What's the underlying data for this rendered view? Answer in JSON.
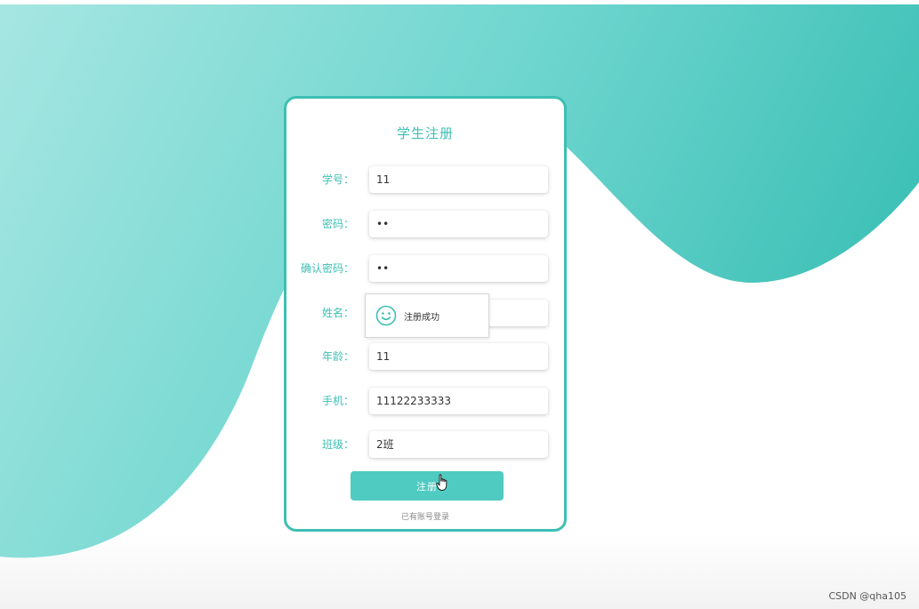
{
  "form": {
    "title": "学生注册",
    "fields": [
      {
        "label": "学号：",
        "value": "11"
      },
      {
        "label": "密码：",
        "value": "••"
      },
      {
        "label": "确认密码：",
        "value": "••"
      },
      {
        "label": "姓名：",
        "value": ""
      },
      {
        "label": "年龄：",
        "value": "11"
      },
      {
        "label": "手机：",
        "value": "11122233333"
      },
      {
        "label": "班级：",
        "value": "2班"
      }
    ],
    "submit_label": "注册",
    "login_link": "已有账号登录"
  },
  "toast": {
    "message": "注册成功",
    "icon": "smile-icon"
  },
  "watermark": "CSDN @qha105",
  "colors": {
    "accent": "#3dbfb4",
    "button": "#4fcbc1",
    "bg_light": "#a8e6e2",
    "bg_dark": "#3fc1b7"
  }
}
